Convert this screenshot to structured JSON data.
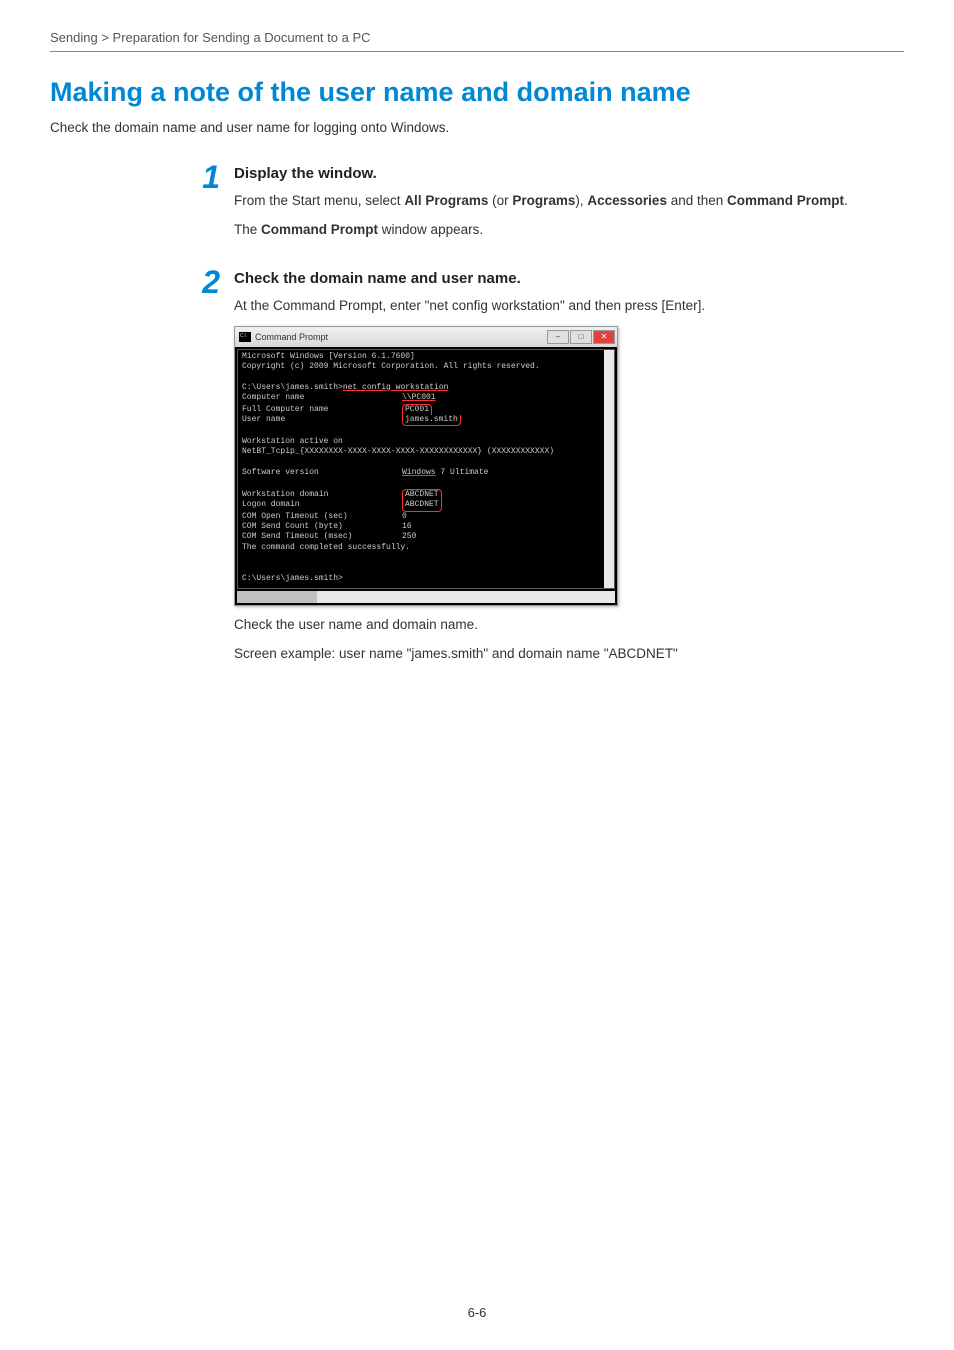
{
  "breadcrumb": "Sending > Preparation for Sending a Document to a PC",
  "heading": "Making a note of the user name and domain name",
  "intro": "Check the domain name and user name for logging onto Windows.",
  "steps": [
    {
      "number": "1",
      "title": "Display the window.",
      "body1_pre": "From the Start menu, select ",
      "body1_b1": "All Programs",
      "body1_mid1": " (or ",
      "body1_b2": "Programs",
      "body1_mid2": "), ",
      "body1_b3": "Accessories",
      "body1_mid3": " and then ",
      "body1_b4": "Command Prompt",
      "body1_end": ".",
      "body2_pre": "The ",
      "body2_b": "Command Prompt",
      "body2_end": " window appears."
    },
    {
      "number": "2",
      "title": "Check the domain name and user name.",
      "body1": "At the Command Prompt, enter \"net config workstation\" and then press [Enter].",
      "body2": "Check the user name and domain name.",
      "body3": "Screen example: user name \"james.smith\" and domain name \"ABCDNET\""
    }
  ],
  "cmd": {
    "title": "Command Prompt",
    "lines": {
      "l1": "Microsoft Windows [Version 6.1.7600]",
      "l2": "Copyright (c) 2009 Microsoft Corporation.  All rights reserved.",
      "l3a": "C:\\Users\\james.smith>",
      "l3b": "net config workstation",
      "l4a": "Computer name",
      "l4b": "\\\\PC001",
      "l5a": "Full Computer name",
      "l5b": "PC001",
      "l6a": "User name",
      "l6b": "james.smith",
      "l7": "Workstation active on",
      "l8": "        NetBT_Tcpip_{XXXXXXXX-XXXX-XXXX-XXXX-XXXXXXXXXXXX} (XXXXXXXXXXXX)",
      "l9a": "Software version",
      "l9b": "Windows",
      "l9c": " 7 Ultimate",
      "l10a": "Workstation domain",
      "l10b": "ABCDNET",
      "l11a": "Logon domain",
      "l11b": "ABCDNET",
      "l12a": "COM Open Timeout (sec)",
      "l12b": "0",
      "l13a": "COM Send Count (byte)",
      "l13b": "16",
      "l14a": "COM Send Timeout (msec)",
      "l14b": "250",
      "l15": "The command completed successfully.",
      "l16": "C:\\Users\\james.smith>"
    }
  },
  "page_number": "6-6"
}
